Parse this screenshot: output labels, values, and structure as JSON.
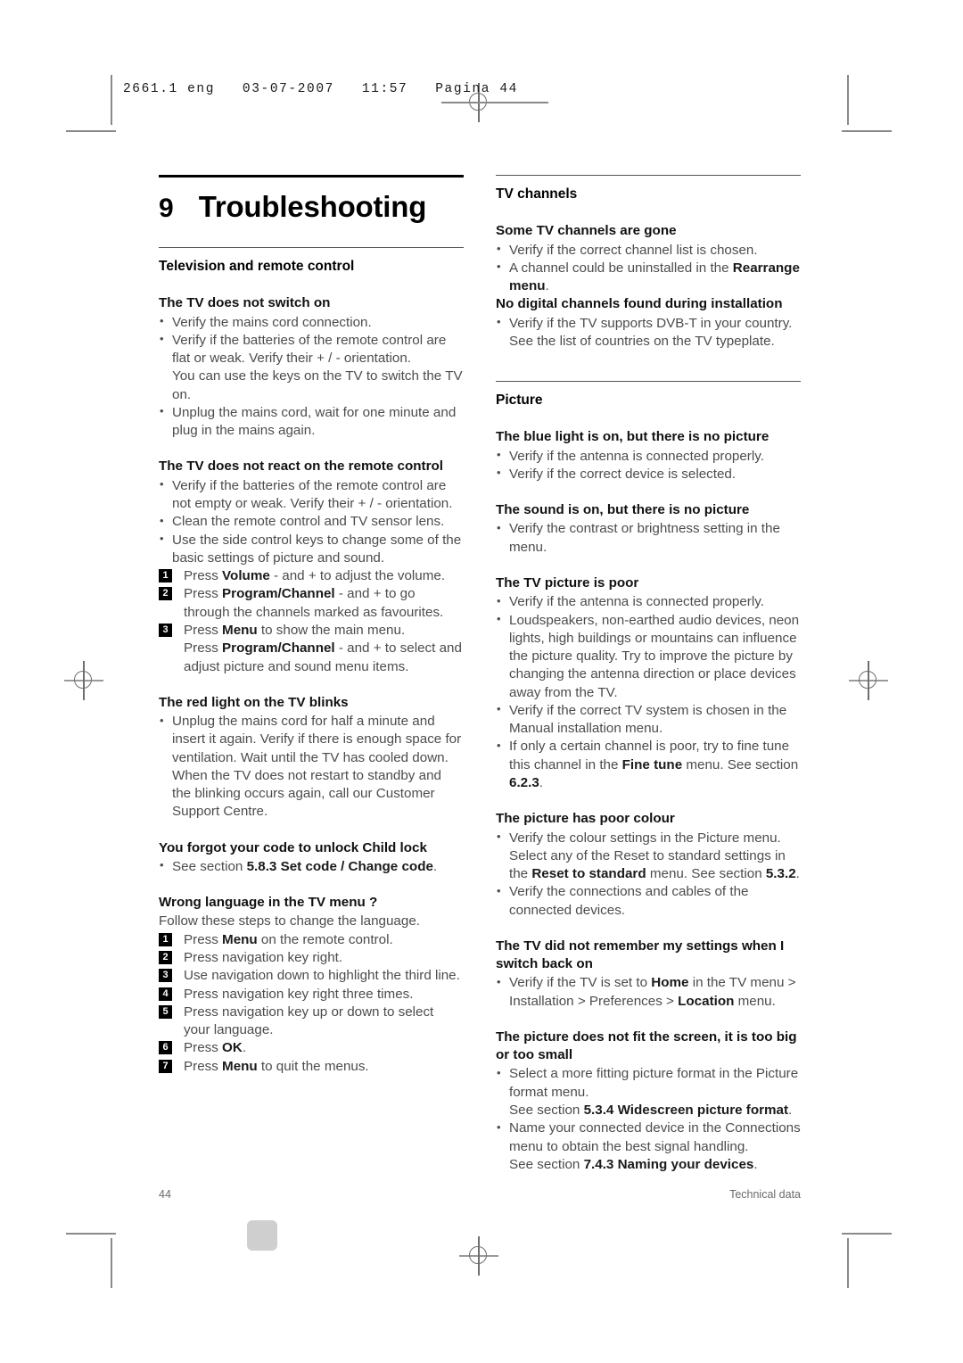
{
  "header": {
    "slug": "2661.1 eng   03-07-2007   11:57   Pagina 44"
  },
  "chapter": {
    "number": "9",
    "title": "Troubleshooting"
  },
  "footer": {
    "page_number": "44",
    "section_label": "Technical data"
  },
  "left_column": {
    "section_title": "Television and remote control",
    "blocks": [
      {
        "heading": "The TV does not switch on",
        "items": [
          {
            "type": "bullet",
            "text": "Verify the mains cord connection."
          },
          {
            "type": "bullet",
            "text": "Verify if the batteries of the remote control are flat or weak. Verify their + / - orientation."
          },
          {
            "type": "cont",
            "text": "You can use the keys on the TV to switch the TV on."
          },
          {
            "type": "bullet",
            "text": "Unplug the mains cord, wait for one minute and plug in the mains again."
          }
        ]
      },
      {
        "heading": "The TV does not react on the remote control",
        "items": [
          {
            "type": "bullet",
            "text": "Verify if the batteries of the remote control are not empty or weak. Verify their + / - orientation."
          },
          {
            "type": "bullet",
            "text": "Clean the remote control and TV sensor lens."
          },
          {
            "type": "bullet",
            "text": "Use the side control keys to change some of the basic settings of picture and sound."
          },
          {
            "type": "step",
            "num": "1",
            "pre": "Press ",
            "bold": "Volume",
            "post": " - and + to adjust the volume."
          },
          {
            "type": "step",
            "num": "2",
            "pre": "Press ",
            "bold": "Program/Channel",
            "post": " - and + to go through the channels marked as favourites."
          },
          {
            "type": "step",
            "num": "3",
            "pre": "Press ",
            "bold": "Menu",
            "post": " to show the main menu."
          },
          {
            "type": "step-cont",
            "pre": "Press ",
            "bold": "Program/Channel",
            "post": " - and + to select and adjust picture and sound menu items."
          }
        ]
      },
      {
        "heading": "The red light on the TV blinks",
        "items": [
          {
            "type": "bullet",
            "text": "Unplug the mains cord for half a minute and insert it again. Verify if there is enough space for ventilation. Wait until the TV has cooled down. When the TV does not restart to standby and the blinking occurs again, call our Customer Support Centre."
          }
        ]
      },
      {
        "heading": "You forgot your code to unlock Child lock",
        "items": [
          {
            "type": "bullet-rich",
            "pre": "See section ",
            "bold": "5.8.3 Set code / Change code",
            "post": "."
          }
        ]
      },
      {
        "heading": "Wrong language in the TV menu ?",
        "items": [
          {
            "type": "para",
            "text": "Follow these steps to change the language."
          },
          {
            "type": "step",
            "num": "1",
            "pre": "Press ",
            "bold": "Menu",
            "post": " on the remote control."
          },
          {
            "type": "step",
            "num": "2",
            "pre": "Press navigation key right.",
            "bold": "",
            "post": ""
          },
          {
            "type": "step",
            "num": "3",
            "pre": "Use navigation down to highlight the third line.",
            "bold": "",
            "post": ""
          },
          {
            "type": "step",
            "num": "4",
            "pre": "Press navigation key right three times.",
            "bold": "",
            "post": ""
          },
          {
            "type": "step",
            "num": "5",
            "pre": "Press navigation key up or down to select your language.",
            "bold": "",
            "post": ""
          },
          {
            "type": "step",
            "num": "6",
            "pre": "Press ",
            "bold": "OK",
            "post": "."
          },
          {
            "type": "step",
            "num": "7",
            "pre": "Press ",
            "bold": "Menu",
            "post": " to quit the menus."
          }
        ]
      }
    ]
  },
  "right_column": {
    "sections": [
      {
        "section_title": "TV channels",
        "blocks": [
          {
            "heading": "Some TV channels are gone",
            "items": [
              {
                "type": "bullet",
                "text": "Verify if the correct channel list is chosen."
              },
              {
                "type": "bullet-rich",
                "pre": "A channel could be uninstalled in the ",
                "bold": "Rearrange menu",
                "post": "."
              }
            ]
          },
          {
            "heading": "No digital channels found during installation",
            "items": [
              {
                "type": "bullet",
                "text": "Verify if the TV supports DVB-T in your country. See the list of countries on the TV typeplate."
              }
            ]
          }
        ]
      },
      {
        "section_title": "Picture",
        "blocks": [
          {
            "heading": "The blue light is on, but there is no picture",
            "items": [
              {
                "type": "bullet",
                "text": "Verify if the antenna is connected properly."
              },
              {
                "type": "bullet",
                "text": "Verify if the correct device is selected."
              }
            ]
          },
          {
            "heading": "The sound is on, but there is no picture",
            "items": [
              {
                "type": "bullet",
                "text": "Verify the contrast or brightness setting in the menu."
              }
            ]
          },
          {
            "heading": "The TV picture is poor",
            "items": [
              {
                "type": "bullet",
                "text": "Verify if the antenna is connected properly."
              },
              {
                "type": "bullet",
                "text": "Loudspeakers, non-earthed audio devices, neon lights, high buildings or mountains can influence the picture quality. Try to improve the picture by changing the antenna direction or place devices away from the TV."
              },
              {
                "type": "bullet",
                "text": "Verify if the correct TV system is chosen in the Manual installation menu."
              },
              {
                "type": "bullet-rich",
                "pre": "If only a certain channel is poor, try to fine tune this channel in the ",
                "bold": "Fine tune",
                "post": " menu. See section ",
                "bold2": "6.2.3",
                "post2": "."
              }
            ]
          },
          {
            "heading": "The picture has poor colour",
            "items": [
              {
                "type": "bullet-rich",
                "pre": "Verify the colour settings in the Picture menu. Select any of the Reset to standard settings in the ",
                "bold": "Reset to standard",
                "post": " menu. See section ",
                "bold2": "5.3.2",
                "post2": "."
              },
              {
                "type": "bullet",
                "text": "Verify the connections and cables of the connected devices."
              }
            ]
          },
          {
            "heading": "The TV did not remember my settings when I switch back on",
            "items": [
              {
                "type": "bullet-rich",
                "pre": "Verify if the TV is set to ",
                "bold": "Home",
                "post": " in the TV menu > Installation > Preferences > ",
                "bold2": "Location",
                "post2": " menu."
              }
            ]
          },
          {
            "heading": "The picture does not fit the screen, it is too big or too small",
            "items": [
              {
                "type": "bullet",
                "text": "Select a more fitting picture format in the Picture format menu."
              },
              {
                "type": "cont-rich",
                "pre": "See section ",
                "bold": "5.3.4 Widescreen picture format",
                "post": "."
              },
              {
                "type": "bullet",
                "text": "Name your connected device in the Connections menu to obtain the best signal handling."
              },
              {
                "type": "cont-rich",
                "pre": "See section ",
                "bold": "7.4.3 Naming your devices",
                "post": "."
              }
            ]
          }
        ]
      }
    ]
  }
}
